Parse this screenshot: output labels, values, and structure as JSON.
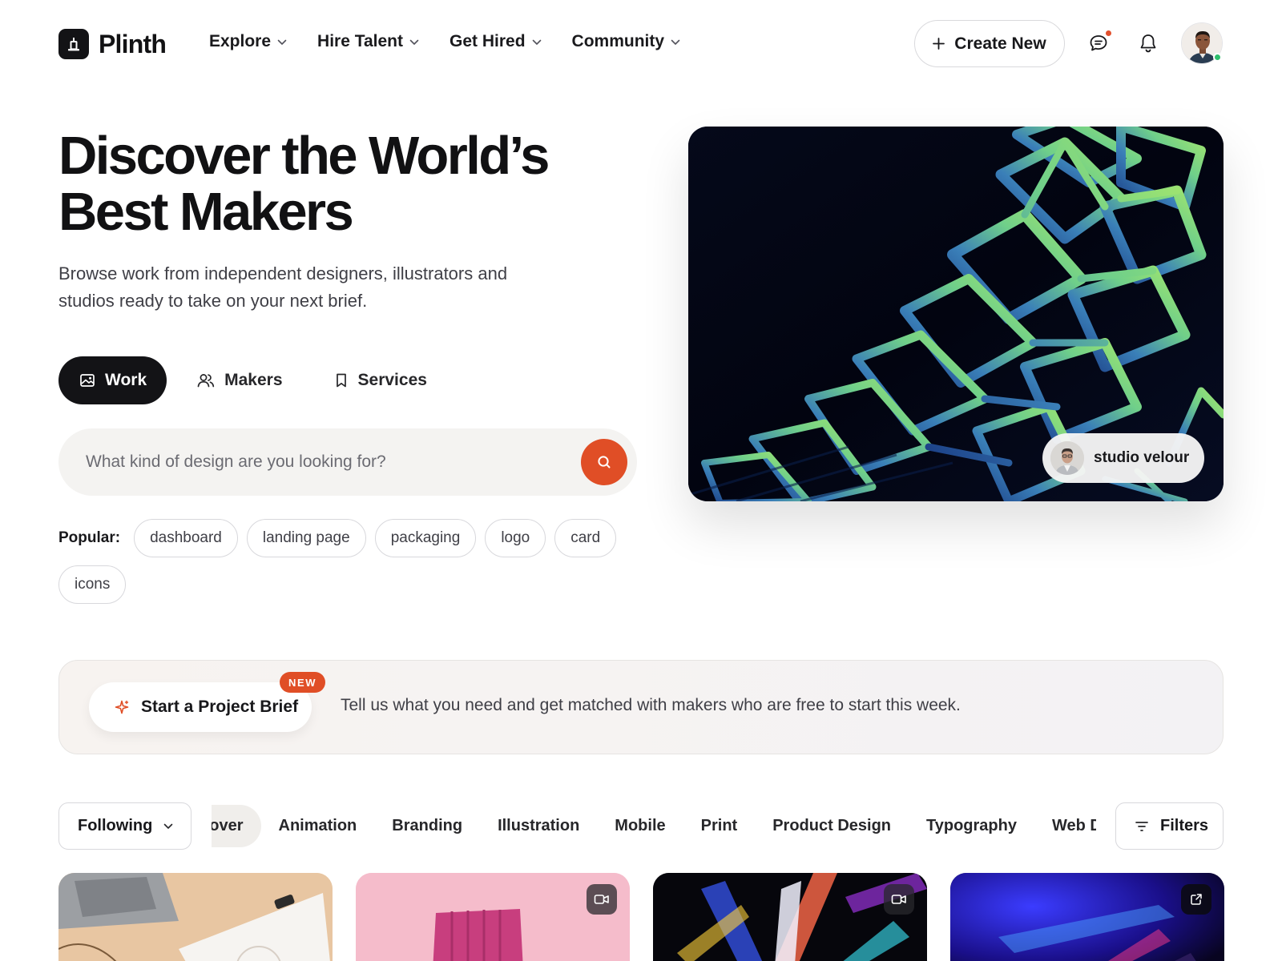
{
  "brand": {
    "name": "Plinth"
  },
  "nav": {
    "items": [
      {
        "label": "Explore"
      },
      {
        "label": "Hire Talent"
      },
      {
        "label": "Get Hired"
      },
      {
        "label": "Community"
      }
    ],
    "create_label": "Create New"
  },
  "hero": {
    "title_line1": "Discover the World’s",
    "title_line2": "Best Makers",
    "subtitle_line1": "Browse work from independent designers, illustrators and",
    "subtitle_line2": "studios ready to take on your next brief.",
    "tabs": [
      {
        "label": "Work",
        "active": true
      },
      {
        "label": "Makers",
        "active": false
      },
      {
        "label": "Services",
        "active": false
      }
    ],
    "search_placeholder": "What kind of design are you looking for?",
    "popular_label": "Popular:",
    "popular_tags": [
      "dashboard",
      "landing page",
      "packaging",
      "logo",
      "card",
      "icons"
    ],
    "featured_credit": "studio velour"
  },
  "brief_banner": {
    "button_label": "Start a Project Brief",
    "badge": "NEW",
    "text": "Tell us what you need and get matched with makers who are free to start this week."
  },
  "categories": {
    "following_label": "Following",
    "items": [
      "Discover",
      "Animation",
      "Branding",
      "Illustration",
      "Mobile",
      "Print",
      "Product Design",
      "Typography",
      "Web Design"
    ],
    "active_item": "Discover",
    "filters_label": "Filters"
  },
  "shots": [
    {
      "kind": "image",
      "badge": ""
    },
    {
      "kind": "video",
      "badge": "video-icon"
    },
    {
      "kind": "video",
      "badge": "video-icon"
    },
    {
      "kind": "link",
      "badge": "external-link-icon"
    }
  ],
  "colors": {
    "accent": "#e04e26",
    "dark": "#131316",
    "online": "#2fbf6c",
    "chip_border": "#d8d8dc"
  }
}
